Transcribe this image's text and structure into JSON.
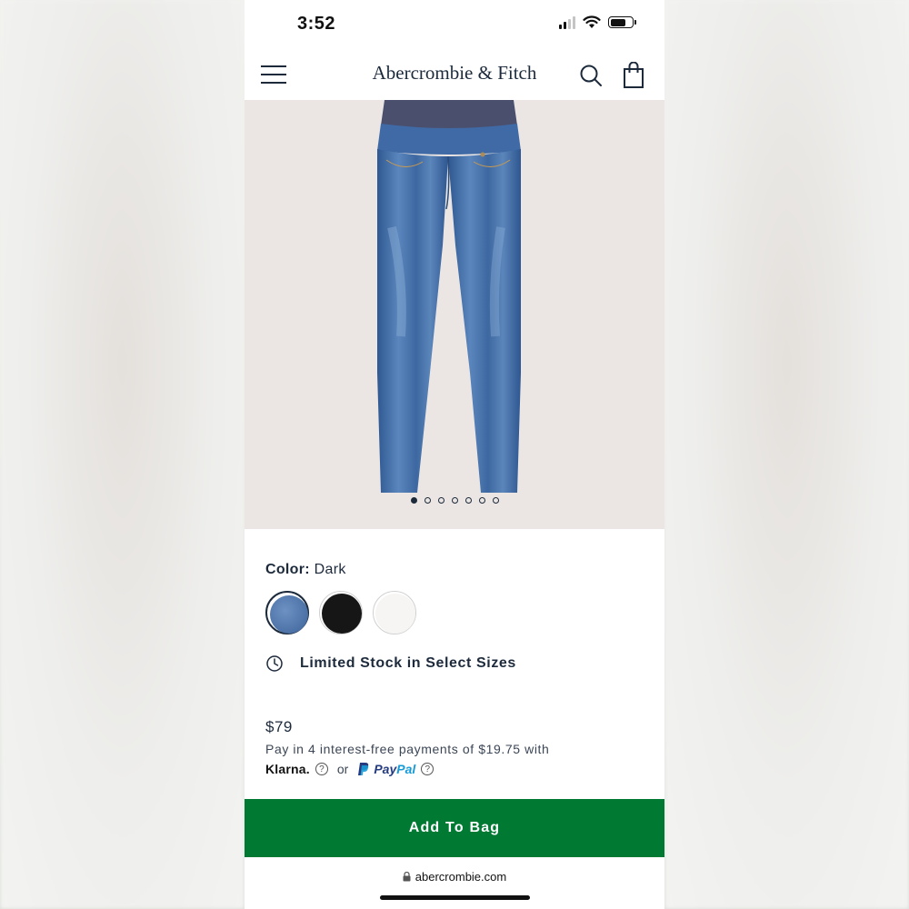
{
  "status_bar": {
    "time": "3:52"
  },
  "header": {
    "brand": "Abercrombie & Fitch"
  },
  "product": {
    "color_label": "Color:",
    "color_value": "Dark",
    "swatches": [
      {
        "name": "Dark",
        "color": "#4a72a8"
      },
      {
        "name": "Black",
        "color": "#161616"
      },
      {
        "name": "White",
        "color": "#f6f5f3"
      }
    ],
    "stock_message": "Limited Stock in Select Sizes",
    "price": "$79",
    "installments": "Pay in 4 interest-free payments of $19.75 with",
    "klarna": "Klarna.",
    "or": "or",
    "paypal_1": "Pay",
    "paypal_2": "Pal",
    "image_count": 7,
    "active_image": 1
  },
  "cta": {
    "add_to_bag": "Add To Bag"
  },
  "browser": {
    "url": "abercrombie.com"
  },
  "colors": {
    "brand_green": "#007a33",
    "navy": "#1c2a3b",
    "image_bg": "#ebe6e3"
  }
}
